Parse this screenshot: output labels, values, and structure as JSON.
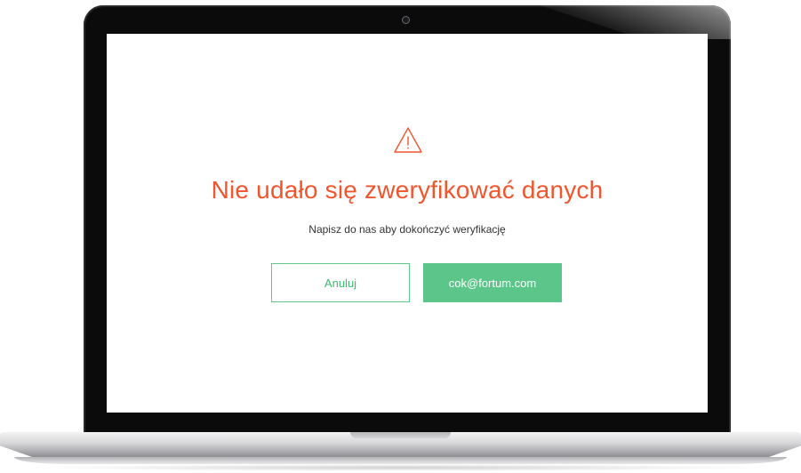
{
  "dialog": {
    "icon": "warning-triangle-icon",
    "title": "Nie udało się zweryfikować danych",
    "message": "Napisz do nas aby dokończyć weryfikację",
    "cancel_label": "Anuluj",
    "email_label": "cok@fortum.com"
  },
  "colors": {
    "title": "#f0562e",
    "warning_icon": "#f0562e",
    "primary_button": "#5cc589",
    "secondary_border": "#5fc98a",
    "bezel": "#0b0b0c",
    "screen_background": "#ffffff"
  }
}
